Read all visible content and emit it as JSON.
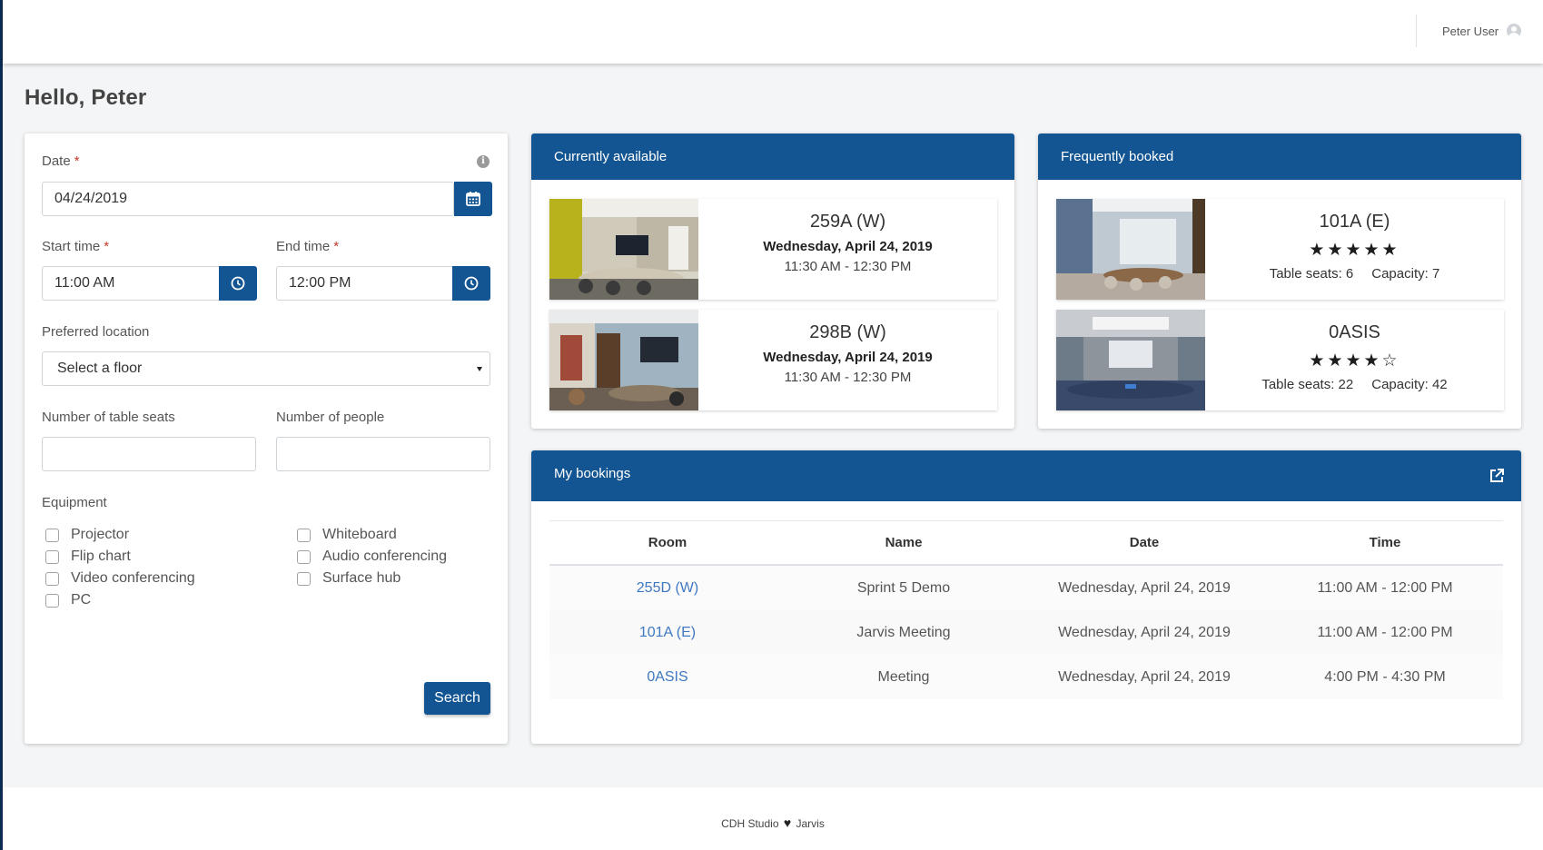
{
  "user": {
    "name": "Peter User"
  },
  "greeting": "Hello, Peter",
  "form": {
    "date_label": "Date",
    "date_value": "04/24/2019",
    "start_label": "Start time",
    "start_value": "11:00 AM",
    "end_label": "End time",
    "end_value": "12:00 PM",
    "location_label": "Preferred location",
    "location_value": "Select a floor",
    "seats_label": "Number of table seats",
    "people_label": "Number of people",
    "equipment_label": "Equipment",
    "equipment": [
      "Projector",
      "Flip chart",
      "Video conferencing",
      "PC",
      "Whiteboard",
      "Audio conferencing",
      "Surface hub"
    ],
    "search_label": "Search",
    "required_mark": "*",
    "info_glyph": "i"
  },
  "available": {
    "title": "Currently available",
    "rooms": [
      {
        "name": "259A (W)",
        "date": "Wednesday, April 24, 2019",
        "time": "11:30 AM - 12:30 PM"
      },
      {
        "name": "298B (W)",
        "date": "Wednesday, April 24, 2019",
        "time": "11:30 AM - 12:30 PM"
      }
    ]
  },
  "frequent": {
    "title": "Frequently booked",
    "rooms": [
      {
        "name": "101A (E)",
        "stars": "★★★★★",
        "rating": 5,
        "seats": "Table seats: 6",
        "capacity": "Capacity: 7"
      },
      {
        "name": "0ASIS",
        "stars": "★★★★☆",
        "rating": 4,
        "seats": "Table seats: 22",
        "capacity": "Capacity: 42"
      }
    ]
  },
  "bookings": {
    "title": "My bookings",
    "columns": [
      "Room",
      "Name",
      "Date",
      "Time"
    ],
    "rows": [
      {
        "room": "255D (W)",
        "name": "Sprint 5 Demo",
        "date": "Wednesday, April 24, 2019",
        "time": "11:00 AM - 12:00 PM"
      },
      {
        "room": "101A (E)",
        "name": "Jarvis Meeting",
        "date": "Wednesday, April 24, 2019",
        "time": "11:00 AM - 12:00 PM"
      },
      {
        "room": "0ASIS",
        "name": "Meeting",
        "date": "Wednesday, April 24, 2019",
        "time": "4:00 PM - 4:30 PM"
      }
    ]
  },
  "footer": {
    "left": "CDH Studio",
    "heart": "♥",
    "right": "Jarvis"
  },
  "colors": {
    "primary": "#135592",
    "accent_dark": "#0c2b53",
    "link": "#3f78c0"
  }
}
